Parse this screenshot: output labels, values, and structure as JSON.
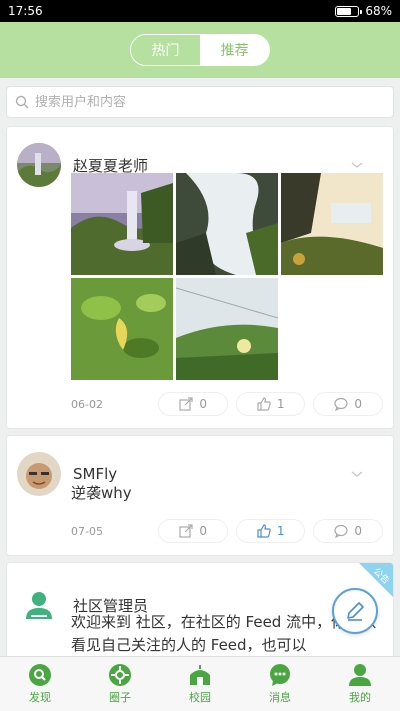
{
  "status_bar": {
    "time": "17:56",
    "battery": "68%",
    "battery_level": 0.68
  },
  "header": {
    "tabs": [
      {
        "label": "热门",
        "active": false
      },
      {
        "label": "推荐",
        "active": true
      }
    ]
  },
  "search": {
    "placeholder": "搜索用户和内容"
  },
  "feed": [
    {
      "author": "赵夏夏老师",
      "date": "06-02",
      "shares": "0",
      "likes": "1",
      "comments": "0",
      "photos": [
        "waterfall-1",
        "waterfall-2",
        "waterfall-3",
        "leaves",
        "grass-flowers"
      ]
    },
    {
      "author": "SMFly",
      "text": "逆袭why",
      "date": "07-05",
      "shares": "0",
      "likes": "1",
      "comments": "0"
    },
    {
      "author": "社区管理员",
      "badge": "公告",
      "text": "欢迎来到 社区，在社区的 Feed 流中，你可以看见自己关注的人的 Feed，也可以"
    }
  ],
  "bottom_nav": [
    {
      "label": "发现",
      "icon": "discover-icon"
    },
    {
      "label": "圈子",
      "icon": "circle-icon"
    },
    {
      "label": "校园",
      "icon": "campus-icon"
    },
    {
      "label": "消息",
      "icon": "message-icon"
    },
    {
      "label": "我的",
      "icon": "profile-icon"
    }
  ],
  "colors": {
    "accent": "#84c768",
    "nav_green": "#4aa641",
    "header_bg": "#b5e0a0",
    "link_blue": "#4a8fd6"
  }
}
